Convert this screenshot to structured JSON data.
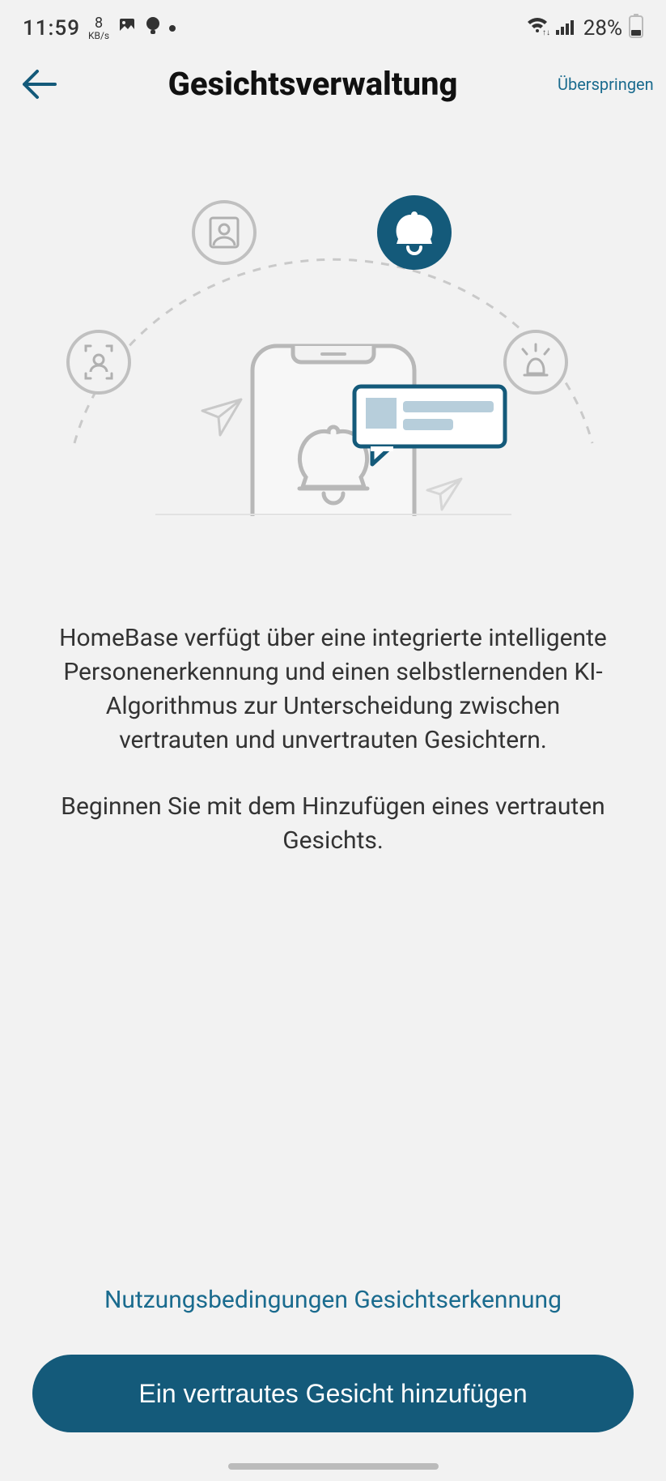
{
  "status": {
    "time": "11:59",
    "kbs_value": "8",
    "kbs_unit": "KB/s",
    "battery_pct": "28%"
  },
  "header": {
    "title": "Gesichtsverwaltung",
    "skip": "Überspringen"
  },
  "body": {
    "p1": "HomeBase verfügt über eine integrierte intelligente Personenerkennung und einen selbstlernenden KI-Algorithmus zur Unterscheidung zwischen vertrauten und unvertrauten Gesichtern.",
    "p2": "Beginnen Sie mit dem Hinzufügen eines vertrauten Gesichts."
  },
  "footer": {
    "terms": "Nutzungsbedingungen Gesichtserkennung",
    "cta": "Ein vertrautes Gesicht hinzufügen"
  },
  "icons": {
    "face_scan": "face-scan-icon",
    "portrait": "portrait-icon",
    "bell": "bell-icon",
    "siren": "siren-icon"
  }
}
